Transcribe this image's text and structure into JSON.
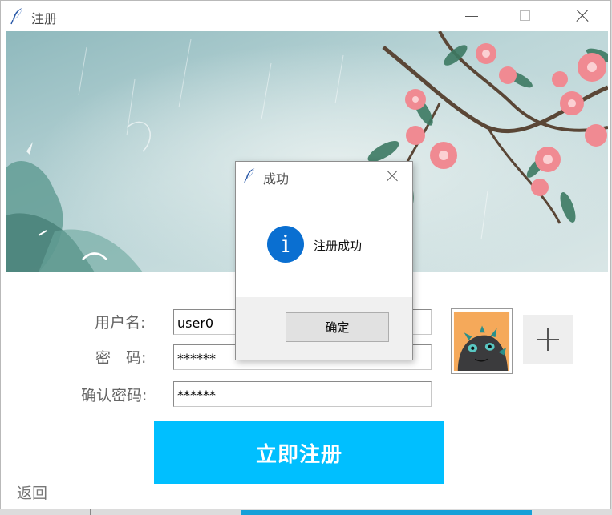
{
  "window": {
    "title": "注册"
  },
  "form": {
    "username_label": "用户名:",
    "password_label": "密　码:",
    "confirm_label": "确认密码:",
    "username_value": "user0",
    "password_value": "******",
    "confirm_value": "******"
  },
  "register_button": "立即注册",
  "back_link": "返回",
  "dialog": {
    "title": "成功",
    "message": "注册成功",
    "ok_label": "确定",
    "icon": "info-icon"
  },
  "icons": {
    "app": "feather-icon",
    "add": "plus-icon",
    "avatar": "dragon-avatar"
  },
  "colors": {
    "register_button": "#00bfff",
    "info_icon": "#0a6fd1"
  }
}
